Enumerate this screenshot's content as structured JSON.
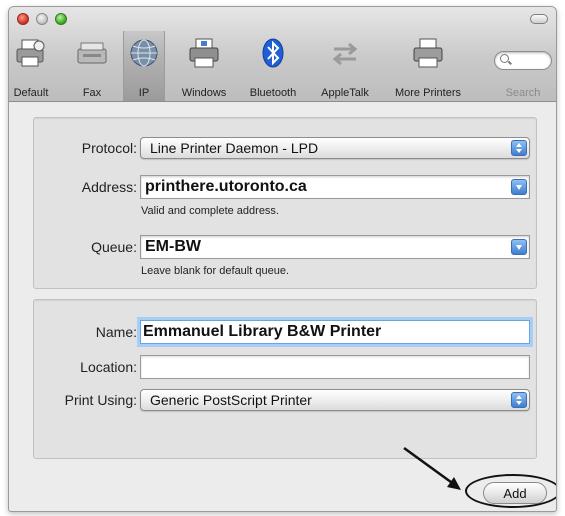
{
  "toolbar": {
    "items": [
      {
        "label": "Default",
        "icon": "default-printer-icon"
      },
      {
        "label": "Fax",
        "icon": "fax-icon"
      },
      {
        "label": "IP",
        "icon": "globe-icon",
        "selected": true
      },
      {
        "label": "Windows",
        "icon": "windows-printer-icon"
      },
      {
        "label": "Bluetooth",
        "icon": "bluetooth-icon"
      },
      {
        "label": "AppleTalk",
        "icon": "appletalk-icon"
      },
      {
        "label": "More Printers",
        "icon": "more-printers-icon"
      }
    ],
    "search_label": "Search"
  },
  "connection": {
    "protocol_label": "Protocol:",
    "protocol_value": "Line Printer Daemon - LPD",
    "address_label": "Address:",
    "address_value": "printhere.utoronto.ca",
    "address_hint": "Valid and complete address.",
    "queue_label": "Queue:",
    "queue_value": "EM-BW",
    "queue_hint": "Leave blank for default queue."
  },
  "printer": {
    "name_label": "Name:",
    "name_value": "Emmanuel Library B&W Printer",
    "location_label": "Location:",
    "location_value": "",
    "print_using_label": "Print Using:",
    "print_using_value": "Generic PostScript Printer"
  },
  "actions": {
    "add_label": "Add"
  },
  "colors": {
    "accent": "#3d7fd0",
    "focus_ring": "#a9cdf5",
    "bluetooth": "#1f5fd6"
  }
}
